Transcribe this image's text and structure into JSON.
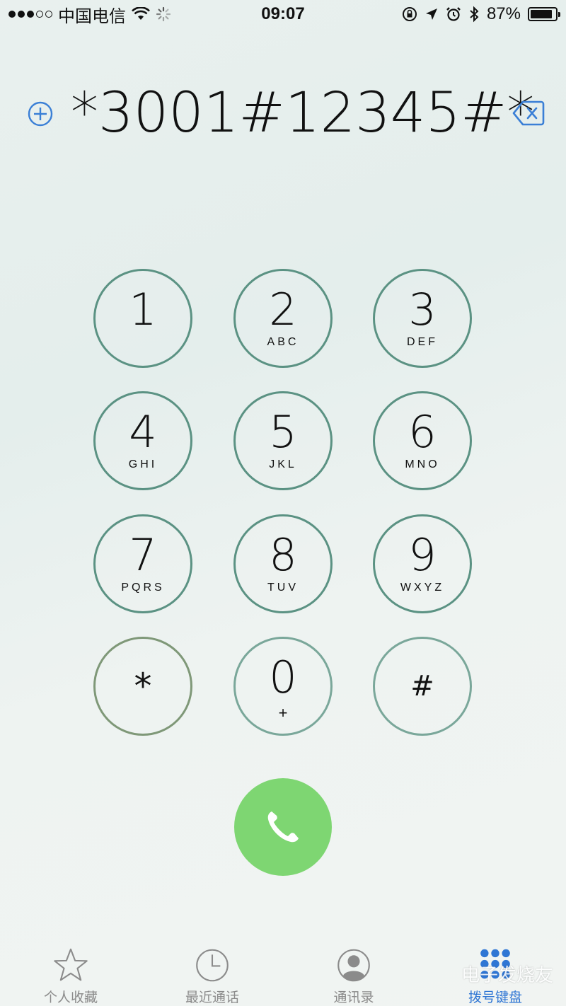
{
  "status_bar": {
    "carrier": "中国电信",
    "time": "09:07",
    "battery_percent": "87%",
    "battery_level": 0.87,
    "signal_dots_filled": 3,
    "signal_dots_total": 5
  },
  "dialer": {
    "number": "*3001#12345#*"
  },
  "keys": [
    {
      "digit": "1",
      "letters": ""
    },
    {
      "digit": "2",
      "letters": "ABC"
    },
    {
      "digit": "3",
      "letters": "DEF"
    },
    {
      "digit": "4",
      "letters": "GHI"
    },
    {
      "digit": "5",
      "letters": "JKL"
    },
    {
      "digit": "6",
      "letters": "MNO"
    },
    {
      "digit": "7",
      "letters": "PQRS"
    },
    {
      "digit": "8",
      "letters": "TUV"
    },
    {
      "digit": "9",
      "letters": "WXYZ"
    },
    {
      "digit": "*",
      "letters": ""
    },
    {
      "digit": "0",
      "letters": "+"
    },
    {
      "digit": "#",
      "letters": ""
    }
  ],
  "tabs": [
    {
      "label": "个人收藏",
      "icon": "star-icon"
    },
    {
      "label": "最近通话",
      "icon": "clock-icon"
    },
    {
      "label": "通讯录",
      "icon": "contact-icon"
    },
    {
      "label": "拨号键盘",
      "icon": "keypad-icon",
      "active": true
    }
  ],
  "watermark": "电子发烧友",
  "colors": {
    "key_ring": "#5b9283",
    "call_green": "#7ed672",
    "active_tab": "#2f76d4",
    "inactive_tab": "#8b8b8b"
  }
}
